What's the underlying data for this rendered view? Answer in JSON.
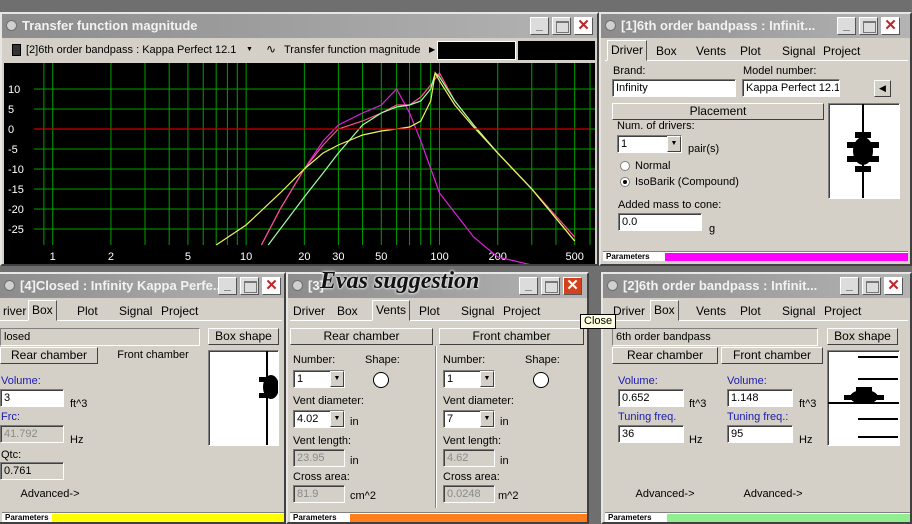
{
  "overlay_title": "Evas suggestion",
  "colors": {
    "title_grad": "#8c8c8c",
    "graph_bg": "#000000",
    "grid": "#00a000",
    "zero_line": "#cc0000",
    "trace_magenta": "#e020e0",
    "trace_pink": "#ff5090",
    "trace_green": "#a0ffa0",
    "trace_yellow": "#f0f060",
    "bar_magenta": "#ff00ff",
    "bar_yellow": "#ffff00",
    "bar_orange": "#ff7f1f",
    "bar_green": "#90ee90"
  },
  "graph_win": {
    "title": "Transfer function magnitude",
    "system_select": "[2]6th order bandpass : Kappa Perfect 12.1",
    "view_select": "Transfer function magnitude"
  },
  "chart_data": {
    "type": "line",
    "title": "Transfer function magnitude",
    "xlabel": "",
    "ylabel": "",
    "x_scale": "log",
    "xlim": [
      0.8,
      600
    ],
    "ylim": [
      -29,
      15
    ],
    "grid": true,
    "x_ticks": [
      1,
      2,
      5,
      10,
      20,
      50,
      100,
      200,
      500
    ],
    "y_ticks": [
      10,
      5,
      0,
      -5,
      -10,
      -15,
      -20,
      -25
    ],
    "x_tick_labels": [
      "1",
      "2",
      "5",
      "10",
      "20",
      "30",
      "50",
      "100",
      "200",
      "500"
    ],
    "series": [
      {
        "color": "#e020e0",
        "x": [
          12,
          15,
          20,
          25,
          30,
          40,
          50,
          60,
          70,
          80,
          100,
          150,
          200,
          300
        ],
        "y": [
          -29,
          -20,
          -10,
          -3,
          1,
          4,
          6,
          10,
          4,
          -3,
          -16,
          -27,
          -32,
          -40
        ]
      },
      {
        "color": "#ff5090",
        "x": [
          12,
          15,
          20,
          25,
          30,
          40,
          50,
          60,
          70,
          80,
          90,
          100,
          120,
          150,
          200,
          300,
          500
        ],
        "y": [
          -29,
          -20,
          -10,
          -4,
          0,
          2,
          4,
          6,
          6,
          8,
          11,
          14,
          7,
          1,
          -6,
          -15,
          -27
        ]
      },
      {
        "color": "#a0ffa0",
        "x": [
          13,
          15,
          20,
          25,
          30,
          40,
          50,
          60,
          70,
          80,
          90,
          95,
          100,
          120,
          150,
          200,
          300,
          500
        ],
        "y": [
          -29,
          -25,
          -17,
          -11,
          -6,
          1,
          4,
          5.5,
          6,
          7,
          10,
          14,
          13,
          7,
          1,
          -6,
          -15,
          -28
        ]
      },
      {
        "color": "#f0f060",
        "x": [
          7,
          10,
          15,
          20,
          25,
          30,
          40,
          50,
          60,
          70,
          80,
          90,
          95,
          100,
          120,
          150,
          200,
          300,
          500
        ],
        "y": [
          -29,
          -24,
          -16,
          -10,
          -6,
          -4,
          -1.5,
          -0.5,
          0,
          0.5,
          2,
          7,
          14,
          12,
          6,
          0.5,
          -6,
          -15,
          -28
        ]
      },
      {
        "color": "#cc0000",
        "x": [
          0.8,
          600
        ],
        "y": [
          0,
          0
        ]
      }
    ]
  },
  "driver_win": {
    "title": "[1]6th order bandpass : Infinit...",
    "tabs": [
      "Driver",
      "Box",
      "Vents",
      "Plot",
      "Signal",
      "Project"
    ],
    "brand_label": "Brand:",
    "brand": "Infinity",
    "model_label": "Model number:",
    "model": "Kappa Perfect 12.1",
    "placement": "Placement",
    "num_label": "Num. of drivers:",
    "num": "1",
    "pairs": "pair(s)",
    "normal": "Normal",
    "isobarik": "IsoBarik (Compound)",
    "mass_label": "Added mass to cone:",
    "mass": "0.0",
    "mass_unit": "g",
    "params": "Parameters"
  },
  "closed_win": {
    "title": "[4]Closed : Infinity Kappa Perfe...",
    "tabs": [
      "river",
      "Box",
      "Plot",
      "Signal",
      "Project"
    ],
    "type": "losed",
    "box_shape": "Box shape",
    "rear": "Rear chamber",
    "front": "Front chamber",
    "vol_label": "Volume:",
    "vol": "3",
    "vol_unit": "ft^3",
    "fc_label": "Frc:",
    "fc": "41.792",
    "fc_unit": "Hz",
    "qtc_label": "Qtc:",
    "qtc": "0.761",
    "advanced": "Advanced->",
    "params": "Parameters"
  },
  "vents_win": {
    "title": "[3]",
    "tabs": [
      "Driver",
      "Box",
      "Vents",
      "Plot",
      "Signal",
      "Project"
    ],
    "rear": "Rear chamber",
    "front": "Front chamber",
    "number_label": "Number:",
    "shape_label": "Shape:",
    "rear_number": "1",
    "front_number": "1",
    "diam_label": "Vent diameter:",
    "rear_diam": "4.02",
    "front_diam": "7",
    "in": "in",
    "len_label": "Vent length:",
    "rear_len": "23.95",
    "front_len": "4.62",
    "area_label": "Cross area:",
    "rear_area": "81.9",
    "rear_area_unit": "cm^2",
    "front_area": "0.0248",
    "front_area_unit": "m^2",
    "params": "Parameters",
    "tooltip": "Close"
  },
  "bp_win": {
    "title": "[2]6th order bandpass : Infinit...",
    "tabs": [
      "Driver",
      "Box",
      "Vents",
      "Plot",
      "Signal",
      "Project"
    ],
    "type": "6th order bandpass",
    "box_shape": "Box shape",
    "rear": "Rear chamber",
    "front": "Front chamber",
    "vol_label": "Volume:",
    "rear_vol": "0.652",
    "front_vol": "1.148",
    "vol_unit": "ft^3",
    "tune_label": "Tuning freq.",
    "front_tune_label": "Tuning freq.:",
    "rear_tune": "36",
    "front_tune": "95",
    "hz": "Hz",
    "advanced": "Advanced->",
    "params": "Parameters"
  }
}
